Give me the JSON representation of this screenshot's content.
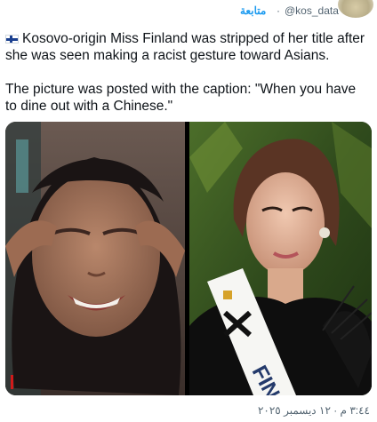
{
  "header": {
    "follow_label": "متابعة",
    "separator": "·",
    "handle": "@kos_data",
    "avatar_icon": "round-profile-avatar"
  },
  "tweet": {
    "flag_icon": "finland-flag-icon",
    "line1": "Kosovo-origin Miss Finland was stripped of her title after she was seen making a racist gesture toward Asians.",
    "line2": "The picture was posted with the caption: \"When you have to dine out with a Chinese.\""
  },
  "media": {
    "left_image": "woman-pulling-eyes-gesture-photo",
    "right_image": "miss-finland-portrait-photo",
    "sash_text": "FIN"
  },
  "footer": {
    "timestamp": "٣:٤٤ م · ١٢ ديسمبر ٢٠٢٥"
  },
  "colors": {
    "link": "#1d9bf0",
    "muted": "#536471",
    "text": "#0f1419"
  }
}
